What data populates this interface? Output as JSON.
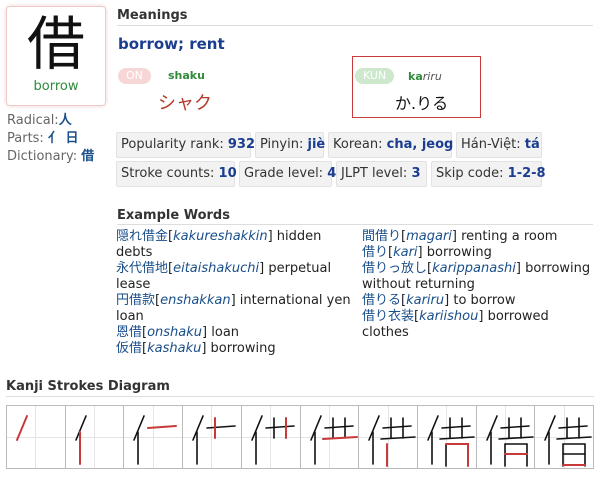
{
  "kanji": {
    "character": "借",
    "gloss": "borrow"
  },
  "info": {
    "radical_label": "Radical:",
    "radical_value": "人",
    "parts_label": "Parts:",
    "parts_value": "亻 日",
    "dictionary_label": "Dictionary:",
    "dictionary_value": "借"
  },
  "meanings": {
    "title": "Meanings",
    "text": "borrow; rent"
  },
  "on_reading": {
    "badge": "ON",
    "romaji": "shaku",
    "kana": "シャク"
  },
  "kun_reading": {
    "badge": "KUN",
    "romaji_main": "ka",
    "romaji_okurigana": "riru",
    "kana": "か.りる"
  },
  "stats": {
    "popularity_label": "Popularity rank:",
    "popularity_value": "932",
    "pinyin_label": "Pinyin:",
    "pinyin_value": "jiè",
    "korean_label": "Korean:",
    "korean_value": "cha, jeog",
    "hanviet_label": "Hán-Việt:",
    "hanviet_value": "tá",
    "strokes_label": "Stroke counts:",
    "strokes_value": "10",
    "grade_label": "Grade level:",
    "grade_value": "4",
    "jlpt_label": "JLPT level:",
    "jlpt_value": "3",
    "skip_label": "Skip code:",
    "skip_value": "1-2-8"
  },
  "examples": {
    "title": "Example Words",
    "left": [
      {
        "jp": "隠れ借金",
        "romaji": "kakureshakkin",
        "meaning": " hidden debts"
      },
      {
        "jp": "永代借地",
        "romaji": "eitaishakuchi",
        "meaning": " perpetual lease"
      },
      {
        "jp": "円借款",
        "romaji": "enshakkan",
        "meaning": " international yen loan"
      },
      {
        "jp": "恩借",
        "romaji": "onshaku",
        "meaning": " loan"
      },
      {
        "jp": "仮借",
        "romaji": "kashaku",
        "meaning": " borrowing"
      }
    ],
    "right": [
      {
        "jp": "間借り",
        "romaji": "magari",
        "meaning": " renting a room"
      },
      {
        "jp": "借り",
        "romaji": "kari",
        "meaning": " borrowing"
      },
      {
        "jp": "借りっ放し",
        "romaji": "karippanashi",
        "meaning": " borrowing without returning"
      },
      {
        "jp": "借りる",
        "romaji": "kariru",
        "meaning": " to borrow"
      },
      {
        "jp": "借り衣装",
        "romaji": "kariishou",
        "meaning": " borrowed clothes"
      }
    ]
  },
  "strokes": {
    "title": "Kanji Strokes Diagram",
    "count": 10
  },
  "colors": {
    "accent_red": "#c83a3a",
    "link_blue": "#1a4f8a",
    "green": "#2f8a3a"
  }
}
